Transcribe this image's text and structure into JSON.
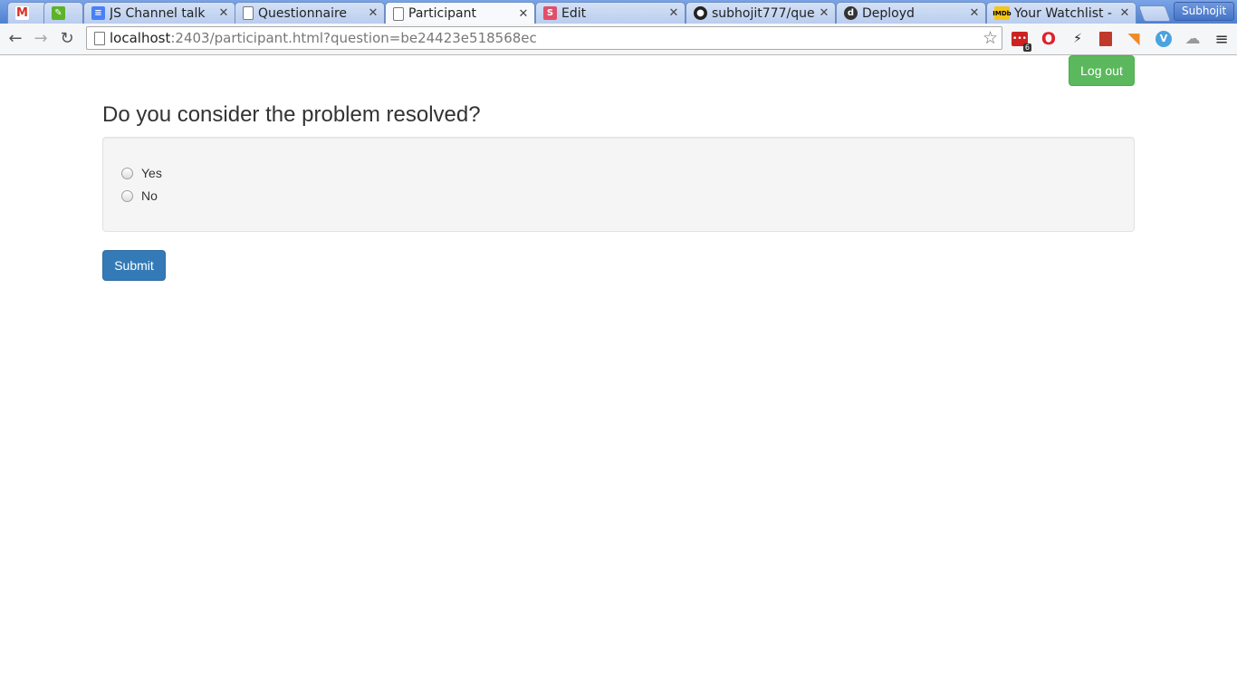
{
  "browser": {
    "tabs": [
      {
        "title": "",
        "icon": "gmail-icon",
        "color": "#d93025"
      },
      {
        "title": "",
        "icon": "evernote-icon",
        "color": "#5bb32a"
      },
      {
        "title": "JS Channel talk",
        "icon": "docs-icon",
        "color": "#4a80f5"
      },
      {
        "title": "Questionnaire",
        "icon": "page-icon",
        "color": "#ffffff"
      },
      {
        "title": "Participant",
        "icon": "page-icon",
        "color": "#ffffff"
      },
      {
        "title": "Edit",
        "icon": "slides-s-icon",
        "color": "#e04f6a"
      },
      {
        "title": "subhojit777/que",
        "icon": "github-icon",
        "color": "#222222"
      },
      {
        "title": "Deployd",
        "icon": "deployd-icon",
        "color": "#333333"
      },
      {
        "title": "Your Watchlist -",
        "icon": "imdb-icon",
        "color": "#f5c518"
      }
    ],
    "profile_name": "Subhojit",
    "url_host": "localhost",
    "url_rest": ":2403/participant.html?question=be24423e518568ec",
    "ext_badge": "6"
  },
  "page": {
    "logout_label": "Log out",
    "question": "Do you consider the problem resolved?",
    "options": [
      "Yes",
      "No"
    ],
    "submit_label": "Submit"
  }
}
